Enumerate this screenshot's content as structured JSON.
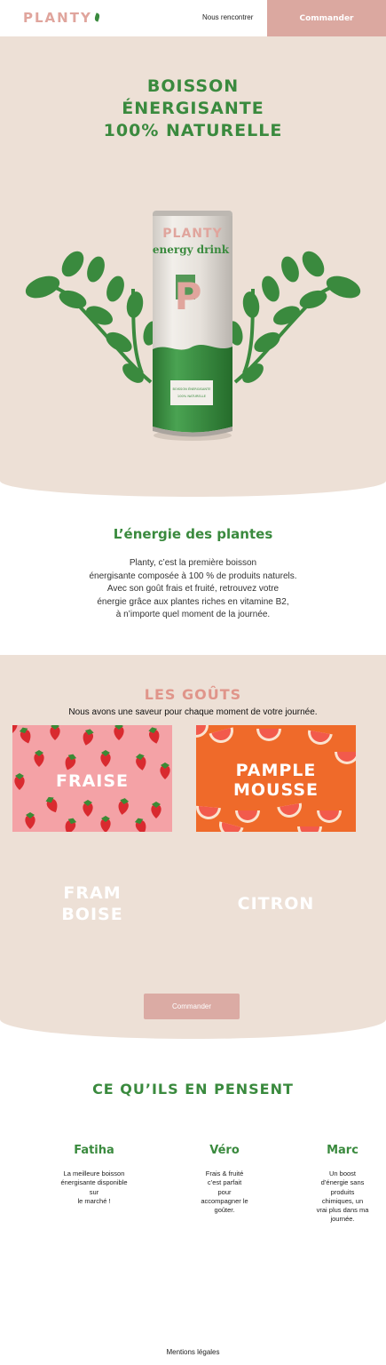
{
  "header": {
    "logo_text": "PLANTY",
    "nav_link": "Nous rencontrer",
    "order_button": "Commander"
  },
  "hero": {
    "title_line1": "BOISSON",
    "title_line2": "ÉNERGISANTE",
    "title_line3": "100% NATURELLE",
    "can": {
      "brand": "PLANTY",
      "subtitle": "energy drink",
      "letter": "P",
      "label_line1": "BOISSON ÉNERGISANTE",
      "label_line2": "100% NATURELLE"
    }
  },
  "intro": {
    "title": "L’énergie des plantes",
    "lines": [
      "Planty, c’est la première boisson",
      "énergisante composée à 100 % de produits naturels.",
      "Avec son goût frais et fruité, retrouvez votre",
      "énergie grâce aux plantes riches en vitamine B2,",
      "à n’importe quel moment de la journée."
    ]
  },
  "tastes": {
    "title": "LES GOÛTS",
    "subtitle": "Nous avons une saveur pour chaque moment de votre journée.",
    "items": [
      {
        "line1": "FRAISE",
        "line2": ""
      },
      {
        "line1": "PAMPLE",
        "line2": "MOUSSE"
      },
      {
        "line1": "FRAM",
        "line2": "BOISE"
      },
      {
        "line1": "CITRON",
        "line2": ""
      }
    ],
    "order_button": "Commander"
  },
  "reviews": {
    "title": "CE QU’ILS EN PENSENT",
    "items": [
      {
        "name": "Fatiha",
        "lines": [
          "La meilleure boisson",
          "énergisante disponible",
          "sur",
          "le marché !"
        ]
      },
      {
        "name": "Véro",
        "lines": [
          "Frais & fruité",
          "c’est parfait",
          "pour",
          "accompagner le",
          "goûter."
        ]
      },
      {
        "name": "Marc",
        "lines": [
          "Un boost",
          "d’énergie sans",
          "produits",
          "chimiques, un",
          "vrai plus dans ma",
          "journée."
        ]
      }
    ]
  },
  "footer": {
    "legal": "Mentions légales"
  },
  "colors": {
    "green": "#3a8a3e",
    "pink": "#e0a59d",
    "beige": "#ede0d6",
    "orange": "#ef6a2a"
  }
}
